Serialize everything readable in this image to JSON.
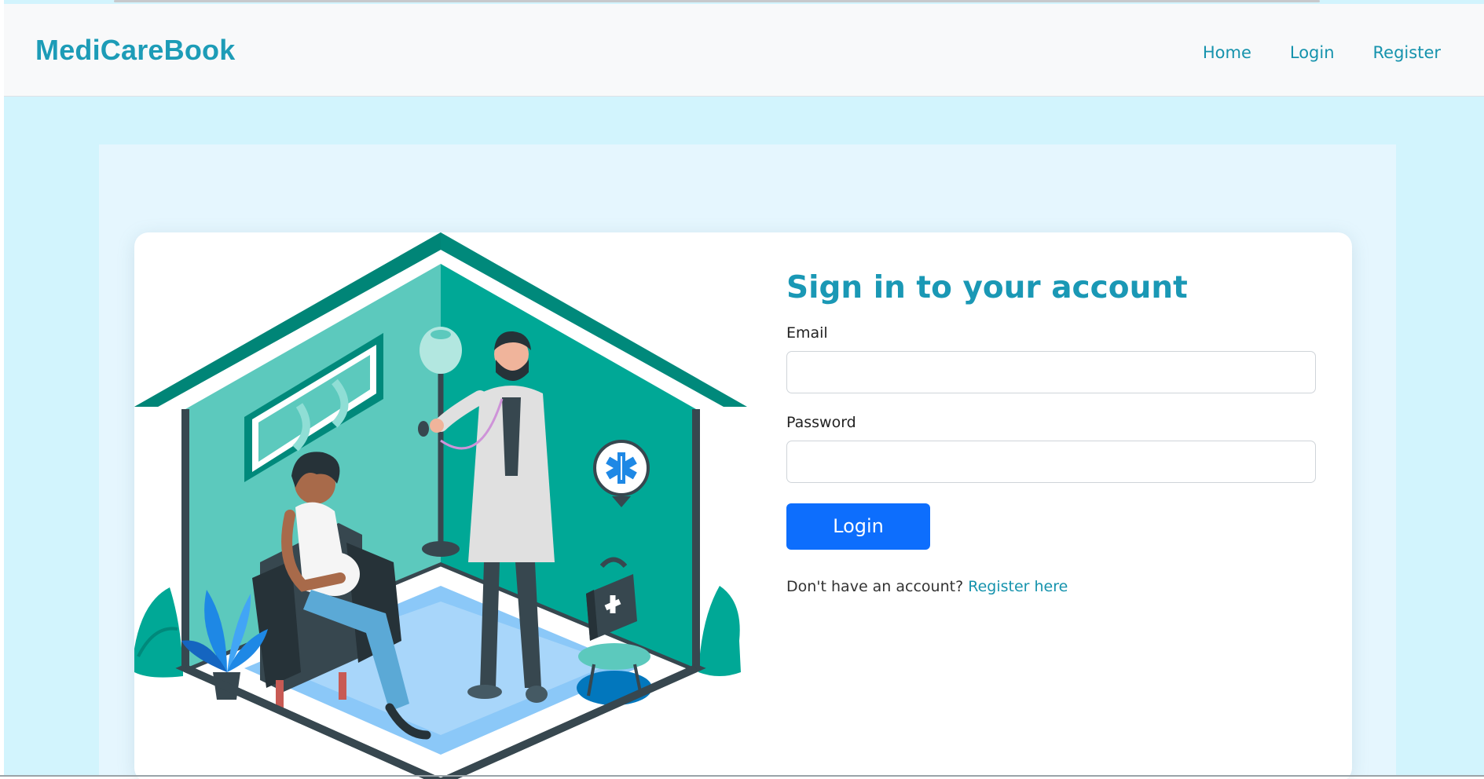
{
  "navbar": {
    "brand": "MediCareBook",
    "links": [
      {
        "label": "Home"
      },
      {
        "label": "Login"
      },
      {
        "label": "Register"
      }
    ]
  },
  "login_form": {
    "title": "Sign in to your account",
    "email_label": "Email",
    "email_value": "",
    "password_label": "Password",
    "password_value": "",
    "submit_label": "Login",
    "register_prompt": "Don't have an account?",
    "register_link": "Register here"
  },
  "colors": {
    "brand": "#1d9cb7",
    "nav_link": "#1693ad",
    "page_background": "#d2f4fd",
    "section_background": "#e5f6fe",
    "primary_button": "#0d6efd",
    "illustration_teal": "#00a896",
    "illustration_dark_teal": "#00897b"
  },
  "icons": {
    "illustration": "doctor-home-visit-illustration",
    "medical_badge": "star-of-life-icon",
    "first_aid": "first-aid-kit-icon"
  }
}
